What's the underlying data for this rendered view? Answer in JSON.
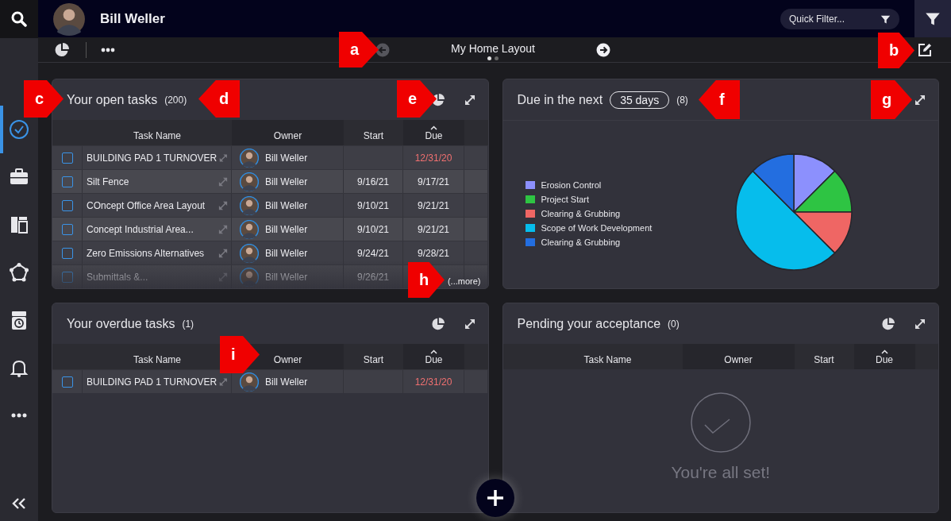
{
  "user": {
    "name": "Bill Weller"
  },
  "quick_filter": {
    "placeholder": "Quick Filter..."
  },
  "sidebar": {
    "items": [
      {
        "kind": "check",
        "selected": true
      },
      {
        "kind": "briefcase",
        "selected": false
      },
      {
        "kind": "layout",
        "selected": false
      },
      {
        "kind": "network",
        "selected": false
      },
      {
        "kind": "timer",
        "selected": false
      },
      {
        "kind": "bell",
        "selected": false
      },
      {
        "kind": "more",
        "selected": false
      }
    ]
  },
  "layout_nav": {
    "title": "My Home Layout",
    "prev_disabled": true,
    "next_disabled": false,
    "pages": [
      {
        "selected": true
      },
      {
        "selected": false
      }
    ]
  },
  "cards": [
    {
      "kind": "table",
      "title": "Your open tasks",
      "count": "(200)",
      "actions": [
        {
          "kind": "chart"
        },
        {
          "kind": "expand"
        }
      ],
      "columns": [
        {
          "label": "Task Name",
          "sorted": false
        },
        {
          "label": "Owner",
          "sorted": false
        },
        {
          "label": "Start",
          "sorted": false
        },
        {
          "label": "Due",
          "sorted": true
        }
      ],
      "rows": [
        {
          "checked": false,
          "task": "BUILDING PAD 1 TURNOVER",
          "owner": "Bill Weller",
          "due": "12/31/20",
          "overdue": true
        },
        {
          "checked": false,
          "task": "Silt Fence",
          "owner": "Bill Weller",
          "start": "9/16/21",
          "due": "9/17/21",
          "overdue": false
        },
        {
          "checked": false,
          "task": "COncept Office Area Layout",
          "owner": "Bill Weller",
          "start": "9/10/21",
          "due": "9/21/21",
          "overdue": false
        },
        {
          "checked": false,
          "task": "Concept Industrial Area...",
          "owner": "Bill Weller",
          "start": "9/10/21",
          "due": "9/21/21",
          "overdue": false
        },
        {
          "checked": false,
          "task": "Zero Emissions Alternatives",
          "owner": "Bill Weller",
          "start": "9/24/21",
          "due": "9/28/21",
          "overdue": false
        },
        {
          "checked": false,
          "task": "Submittals &...",
          "owner": "Bill Weller",
          "start": "9/26/21"
        }
      ],
      "more": "(...more)"
    },
    {
      "kind": "chart",
      "title": "Due in the next",
      "range": "35 days",
      "count": "(8)",
      "actions": [
        {
          "kind": "expand"
        }
      ],
      "legend": [
        {
          "color": "#8c90fd"
        },
        {
          "color": "#2ec443"
        },
        {
          "color": "#ef6664"
        },
        {
          "color": "#06bdec"
        },
        {
          "color": "#236ee0"
        }
      ],
      "chart_data": {
        "type": "pie",
        "categories": [
          "Erosion Control",
          "Project Start",
          "Clearing & Grubbing",
          "Scope of Work Development",
          "Clearing & Grubbing"
        ],
        "values": [
          12.5,
          12.5,
          12.5,
          50,
          12.5
        ]
      }
    },
    {
      "kind": "table",
      "title": "Your overdue tasks",
      "count": "(1)",
      "actions": [
        {
          "kind": "chart"
        },
        {
          "kind": "expand"
        }
      ],
      "columns": [
        {
          "label": "Task Name",
          "sorted": false
        },
        {
          "label": "Owner",
          "sorted": false
        },
        {
          "label": "Start",
          "sorted": false
        },
        {
          "label": "Due",
          "sorted": true
        }
      ],
      "rows": [
        {
          "checked": false,
          "task": "BUILDING PAD 1 TURNOVER",
          "owner": "Bill Weller",
          "due": "12/31/20",
          "overdue": true
        }
      ]
    },
    {
      "kind": "table",
      "title": "Pending your acceptance",
      "count": "(0)",
      "actions": [
        {
          "kind": "chart"
        },
        {
          "kind": "expand"
        }
      ],
      "columns": [
        {
          "label": "Task Name",
          "sorted": false
        },
        {
          "label": "Owner",
          "sorted": false
        },
        {
          "label": "Start",
          "sorted": false
        },
        {
          "label": "Due",
          "sorted": true
        }
      ],
      "empty_message": "You're all set!"
    }
  ],
  "callouts": [
    {
      "label": "a"
    },
    {
      "label": "b"
    },
    {
      "label": "c"
    },
    {
      "label": "d"
    },
    {
      "label": "e"
    },
    {
      "label": "f"
    },
    {
      "label": "g"
    },
    {
      "label": "h"
    },
    {
      "label": "i"
    }
  ]
}
